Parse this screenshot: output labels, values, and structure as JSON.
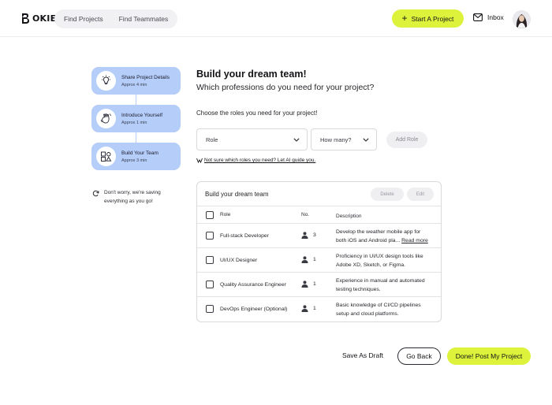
{
  "header": {
    "logo_text": "OKIE",
    "nav": [
      "Find Projects",
      "Find Teammates"
    ],
    "start_button": "Start A Project",
    "inbox_label": "Inbox",
    "accent_color": "#dcf23b"
  },
  "steps": [
    {
      "title": "Share Project Details",
      "duration": "Approx 4 min",
      "icon": "lightbulb-icon"
    },
    {
      "title": "Introduce Yourself",
      "duration": "Approx 1 min",
      "icon": "waving-hand-icon"
    },
    {
      "title": "Build Your Team",
      "duration": "Approx 3 min",
      "icon": "team-blocks-icon"
    }
  ],
  "saving_note": "Don't worry, we're saving everything as you go!",
  "main": {
    "title": "Build your dream team!",
    "subtitle": "Which professions do you need for your project?",
    "choose_label": "Choose the roles you need for your project!",
    "role_select": "Role",
    "count_select": "How many?",
    "add_role": "Add Role",
    "ai_link": "Not sure which roles you need? Let AI guide you."
  },
  "team_card": {
    "title": "Build your dream team",
    "delete_label": "Delete",
    "edit_label": "Edit",
    "columns": [
      "Role",
      "No.",
      "Description"
    ],
    "rows": [
      {
        "role": "Full-stack Developer",
        "count": "3",
        "desc_line1": "Develop the weather mobile app for",
        "desc_line2": "both iOS and Android pla...",
        "read_more": "Read more"
      },
      {
        "role": "UI/UX Designer",
        "count": "1",
        "desc_line1": "Proficiency in UI/UX design tools like",
        "desc_line2": "Adobe XD, Sketch, or Figma.",
        "read_more": ""
      },
      {
        "role": "Quality Assurance Engineer",
        "count": "1",
        "desc_line1": "Experience in manual and automated",
        "desc_line2": "testing techniques.",
        "read_more": ""
      },
      {
        "role": "DevOps Engineer (Optional)",
        "count": "1",
        "desc_line1": "Basic knowledge of CI/CD pipelines",
        "desc_line2": "setup and cloud platforms.",
        "read_more": ""
      }
    ]
  },
  "footer": {
    "save_draft": "Save As Draft",
    "go_back": "Go Back",
    "done": "Done! Post My Project"
  }
}
